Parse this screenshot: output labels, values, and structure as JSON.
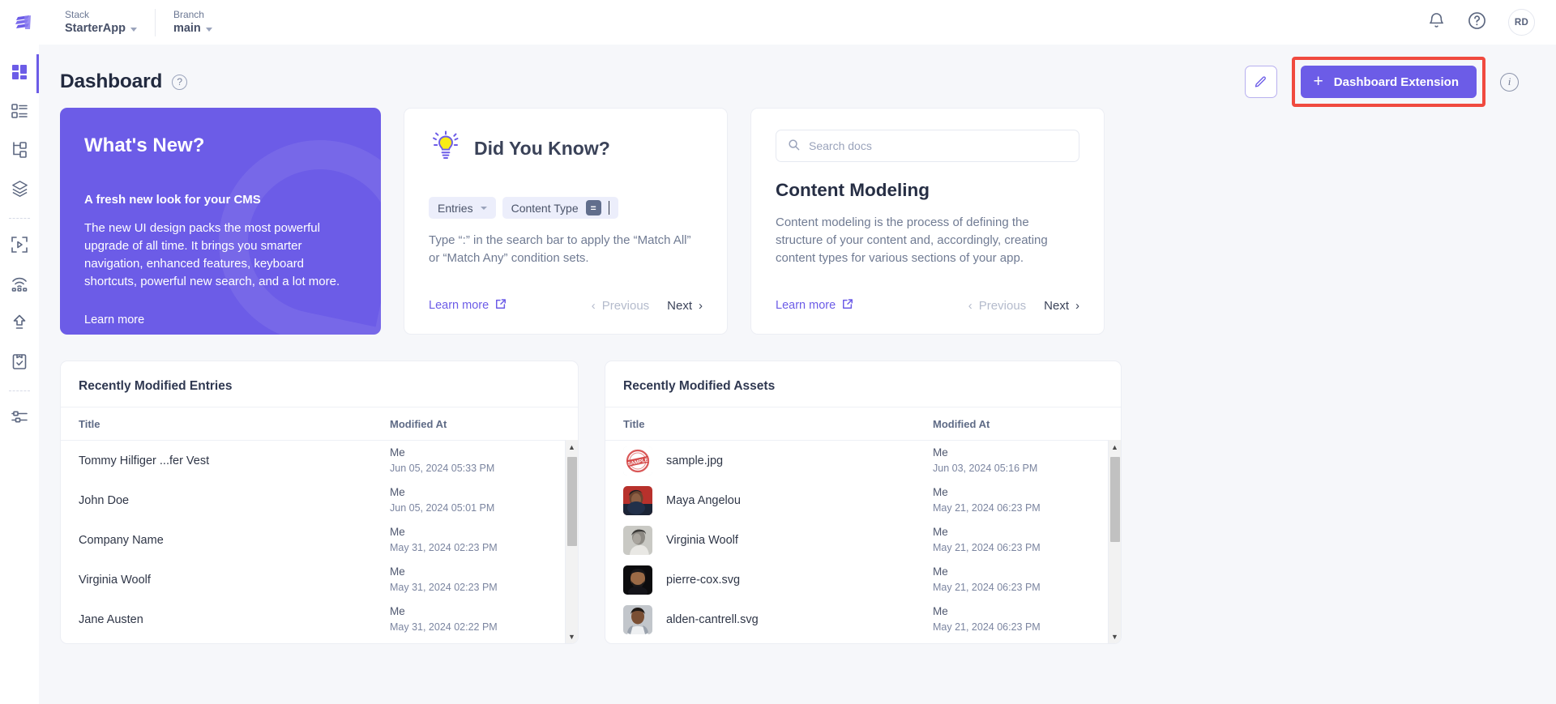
{
  "topbar": {
    "logo_icon": "contentstack-logo-icon",
    "stack": {
      "label": "Stack",
      "value": "StarterApp"
    },
    "branch": {
      "label": "Branch",
      "value": "main"
    },
    "bell_icon": "notification-bell-icon",
    "help_icon": "help-question-icon",
    "avatar_initials": "RD"
  },
  "rail": {
    "items": [
      {
        "name": "sidebar-item-dashboard",
        "icon": "dashboard-grid-icon",
        "active": true
      },
      {
        "name": "sidebar-item-entries",
        "icon": "content-list-icon",
        "active": false
      },
      {
        "name": "sidebar-item-content-types",
        "icon": "sitemap-icon",
        "active": false
      },
      {
        "name": "sidebar-item-assets",
        "icon": "layers-stack-icon",
        "active": false
      },
      {
        "name": "sidebar-item-live-preview",
        "icon": "play-frame-icon",
        "active": false
      },
      {
        "name": "sidebar-item-releases",
        "icon": "broadcast-icon",
        "active": false
      },
      {
        "name": "sidebar-item-publish",
        "icon": "upload-arrow-icon",
        "active": false
      },
      {
        "name": "sidebar-item-workflow",
        "icon": "clipboard-check-icon",
        "active": false
      },
      {
        "name": "sidebar-item-settings",
        "icon": "sliders-settings-icon",
        "active": false
      }
    ]
  },
  "page": {
    "title": "Dashboard",
    "help_icon": "question-circle-icon",
    "edit_icon": "pencil-edit-icon",
    "extension_button": {
      "label": "Dashboard Extension",
      "icon": "plus-icon",
      "highlight_color": "#f04a3f"
    },
    "info_icon": "info-circle-icon",
    "accent_color": "#6c5ce7"
  },
  "whats_new": {
    "title": "What's New?",
    "subtitle": "A fresh new look for your CMS",
    "body": "The new UI design packs the most powerful upgrade of all time. It brings you smarter navigation, enhanced features, keyboard shortcuts, powerful new search, and a lot more.",
    "link": "Learn more"
  },
  "did_you_know": {
    "title": "Did You Know?",
    "bulb_icon": "lightbulb-icon",
    "chip_entries": "Entries",
    "chip_content_type": "Content Type",
    "chip_operator": "=",
    "body": "Type “:” in the search bar to apply the “Match All” or “Match Any” condition sets.",
    "learn_more": "Learn more",
    "external_icon": "external-link-icon",
    "previous": "Previous",
    "next": "Next"
  },
  "content_modeling": {
    "search_placeholder": "Search docs",
    "search_icon": "search-icon",
    "title": "Content Modeling",
    "body": "Content modeling is the process of defining the structure of your content and, accordingly, creating content types for various sections of your app.",
    "learn_more": "Learn more",
    "external_icon": "external-link-icon",
    "previous": "Previous",
    "next": "Next"
  },
  "recent_entries": {
    "panel_title": "Recently Modified Entries",
    "columns": {
      "title": "Title",
      "modified_at": "Modified At"
    },
    "rows": [
      {
        "title": "Tommy Hilfiger ...fer Vest",
        "by": "Me",
        "at": "Jun 05, 2024 05:33 PM"
      },
      {
        "title": "John Doe",
        "by": "Me",
        "at": "Jun 05, 2024 05:01 PM"
      },
      {
        "title": "Company Name",
        "by": "Me",
        "at": "May 31, 2024 02:23 PM"
      },
      {
        "title": "Virginia Woolf",
        "by": "Me",
        "at": "May 31, 2024 02:23 PM"
      },
      {
        "title": "Jane Austen",
        "by": "Me",
        "at": "May 31, 2024 02:22 PM"
      }
    ]
  },
  "recent_assets": {
    "panel_title": "Recently Modified Assets",
    "columns": {
      "title": "Title",
      "modified_at": "Modified At"
    },
    "rows": [
      {
        "title": "sample.jpg",
        "by": "Me",
        "at": "Jun 03, 2024 05:16 PM",
        "thumb": "sample-stamp"
      },
      {
        "title": "Maya Angelou",
        "by": "Me",
        "at": "May 21, 2024 06:23 PM",
        "thumb": "portrait-dark"
      },
      {
        "title": "Virginia Woolf",
        "by": "Me",
        "at": "May 21, 2024 06:23 PM",
        "thumb": "portrait-bw"
      },
      {
        "title": "pierre-cox.svg",
        "by": "Me",
        "at": "May 21, 2024 06:23 PM",
        "thumb": "portrait-beard"
      },
      {
        "title": "alden-cantrell.svg",
        "by": "Me",
        "at": "May 21, 2024 06:23 PM",
        "thumb": "portrait-gray"
      }
    ]
  }
}
